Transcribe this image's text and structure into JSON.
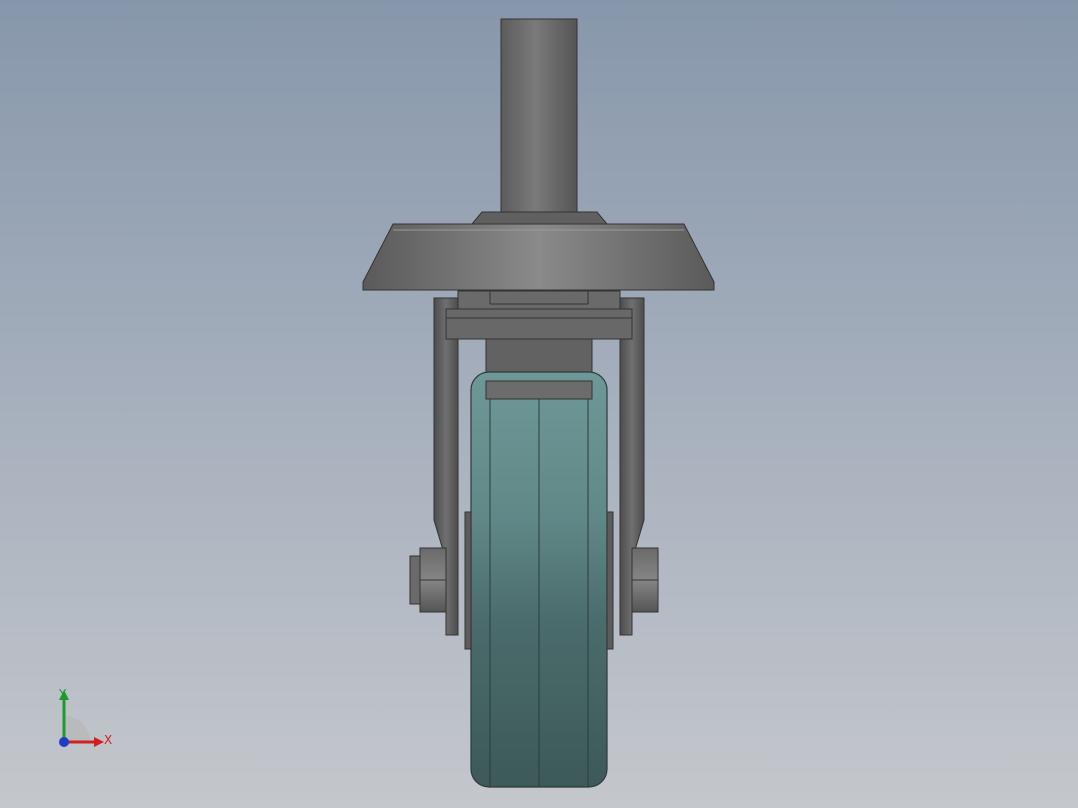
{
  "viewport": {
    "background_top": "#8797ab",
    "background_bottom": "#c4c7cc"
  },
  "model": {
    "metal_color": "#6e6e6e",
    "wheel_color": "#4f7473"
  },
  "triad": {
    "y_label": "Y",
    "x_label": "X",
    "y_color": "#1f9a2b",
    "x_color": "#d02020",
    "z_color": "#1f3ec8"
  }
}
